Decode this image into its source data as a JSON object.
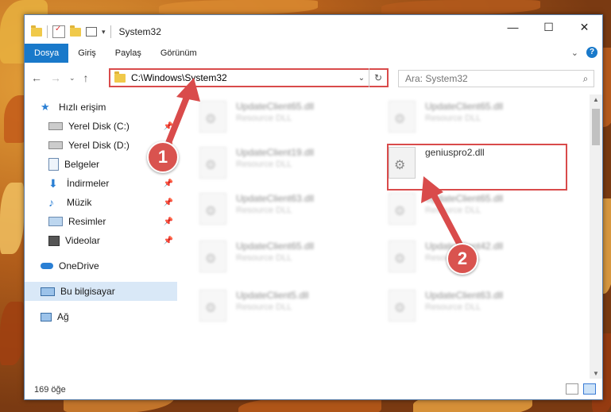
{
  "window": {
    "title": "System32",
    "controls": {
      "minimize": "—",
      "maximize": "☐",
      "close": "✕"
    }
  },
  "ribbon": {
    "tabs": [
      {
        "label": "Dosya",
        "active": true
      },
      {
        "label": "Giriş"
      },
      {
        "label": "Paylaş"
      },
      {
        "label": "Görünüm"
      }
    ],
    "help": "?"
  },
  "address": {
    "path": "C:\\Windows\\System32",
    "search_placeholder": "Ara: System32"
  },
  "sidebar": {
    "items": [
      {
        "label": "Hızlı erişim",
        "icon": "star-icon"
      },
      {
        "label": "Yerel Disk (C:)",
        "icon": "drive-icon",
        "pinned": true
      },
      {
        "label": "Yerel Disk (D:)",
        "icon": "drive-icon",
        "pinned": true
      },
      {
        "label": "Belgeler",
        "icon": "documents-icon"
      },
      {
        "label": "İndirmeler",
        "icon": "downloads-icon",
        "pinned": true
      },
      {
        "label": "Müzik",
        "icon": "music-icon",
        "pinned": true
      },
      {
        "label": "Resimler",
        "icon": "pictures-icon",
        "pinned": true
      },
      {
        "label": "Videolar",
        "icon": "videos-icon",
        "pinned": true
      },
      {
        "label": "OneDrive",
        "icon": "onedrive-icon"
      },
      {
        "label": "Bu bilgisayar",
        "icon": "computer-icon",
        "selected": true
      },
      {
        "label": "Ağ",
        "icon": "network-icon"
      }
    ]
  },
  "files": [
    {
      "name": "UpdateClient65.dll",
      "desc": "Resource DLL"
    },
    {
      "name": "UpdateClient65.dll",
      "desc": "Resource DLL"
    },
    {
      "name": "UpdateClient19.dll",
      "desc": "Resource DLL"
    },
    {
      "name": "geniuspro2.dll",
      "desc": ""
    },
    {
      "name": "UpdateClient63.dll",
      "desc": "Resource DLL"
    },
    {
      "name": "UpdateClient65.dll",
      "desc": "Resource DLL"
    },
    {
      "name": "UpdateClient65.dll",
      "desc": "Resource DLL"
    },
    {
      "name": "UpdateClient42.dll",
      "desc": "Resource DLL"
    },
    {
      "name": "UpdateClient5.dll",
      "desc": "Resource DLL"
    },
    {
      "name": "UpdateClient63.dll",
      "desc": "Resource DLL"
    }
  ],
  "status": {
    "count": "169 öğe"
  },
  "annotations": {
    "badge1": "1",
    "badge2": "2",
    "color": "#d94b4b"
  }
}
